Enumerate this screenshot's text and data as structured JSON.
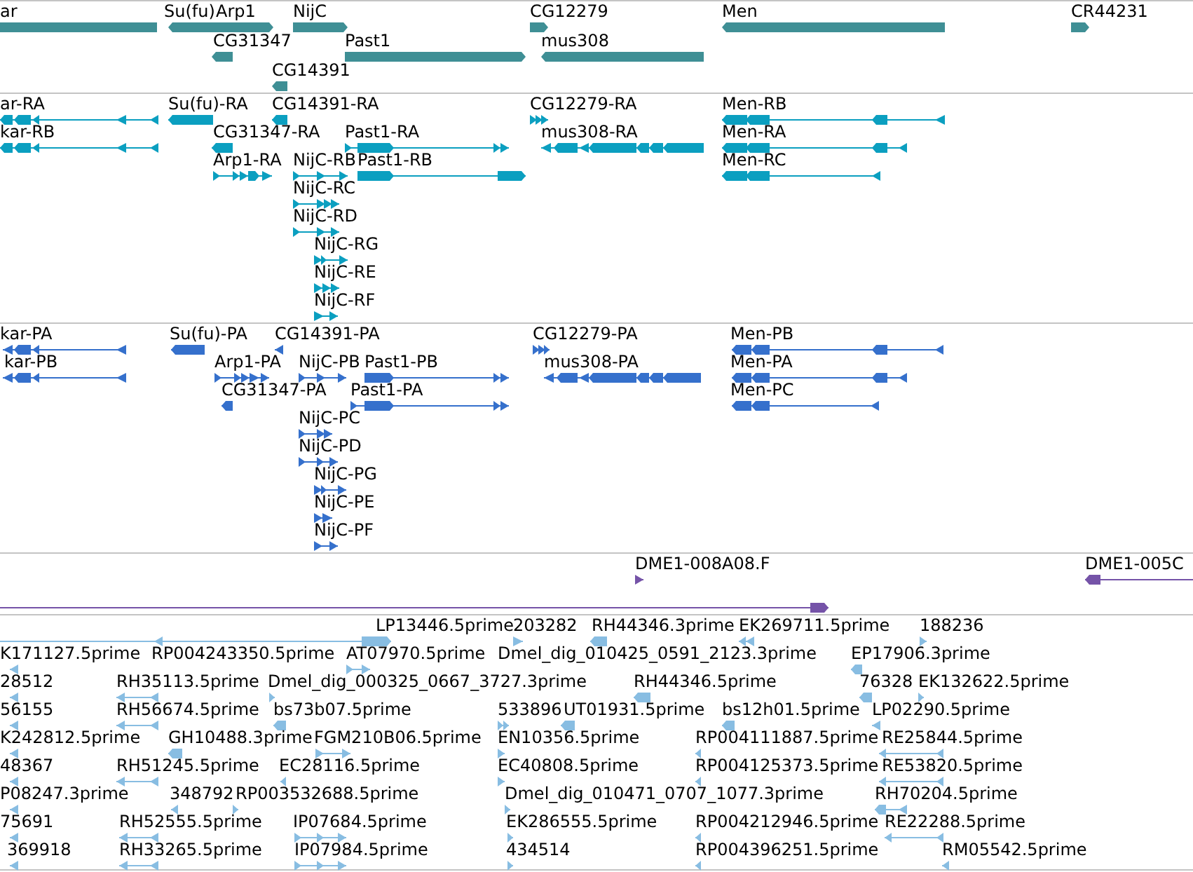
{
  "tracks": [
    {
      "kind": "gene",
      "color": "#3f8f95",
      "features": [
        {
          "label": "ar",
          "reverse": true
        },
        {
          "label": "Su(fu)",
          "reverse": true
        },
        {
          "label": "Arp1",
          "reverse": false
        },
        {
          "label": "NijC",
          "reverse": false
        },
        {
          "label": "CG12279",
          "reverse": false
        },
        {
          "label": "Men",
          "reverse": true
        },
        {
          "label": "CR44231",
          "reverse": false
        },
        {
          "label": "CG31347",
          "reverse": true
        },
        {
          "label": "Past1",
          "reverse": false
        },
        {
          "label": "mus308",
          "reverse": true
        },
        {
          "label": "CG14391",
          "reverse": true
        }
      ]
    },
    {
      "kind": "transcript",
      "color": "#0b9fc0",
      "features": [
        {
          "label": "ar-RA",
          "reverse": true
        },
        {
          "label": "Su(fu)-RA",
          "reverse": true
        },
        {
          "label": "CG14391-RA",
          "reverse": true
        },
        {
          "label": "CG12279-RA",
          "reverse": false
        },
        {
          "label": "Men-RB",
          "reverse": true
        },
        {
          "label": "kar-RB",
          "reverse": true
        },
        {
          "label": "CG31347-RA",
          "reverse": true
        },
        {
          "label": "Past1-RA",
          "reverse": false
        },
        {
          "label": "mus308-RA",
          "reverse": true
        },
        {
          "label": "Men-RA",
          "reverse": true
        },
        {
          "label": "Arp1-RA",
          "reverse": false
        },
        {
          "label": "NijC-RB",
          "reverse": false
        },
        {
          "label": "Past1-RB",
          "reverse": false
        },
        {
          "label": "Men-RC",
          "reverse": true
        },
        {
          "label": "NijC-RC",
          "reverse": false
        },
        {
          "label": "NijC-RD",
          "reverse": false
        },
        {
          "label": "NijC-RG",
          "reverse": false
        },
        {
          "label": "NijC-RE",
          "reverse": false
        },
        {
          "label": "NijC-RF",
          "reverse": false
        }
      ]
    },
    {
      "kind": "protein",
      "color": "#3570cc",
      "features": [
        {
          "label": "kar-PA",
          "reverse": true
        },
        {
          "label": "Su(fu)-PA",
          "reverse": true
        },
        {
          "label": "CG14391-PA",
          "reverse": true
        },
        {
          "label": "CG12279-PA",
          "reverse": false
        },
        {
          "label": "Men-PB",
          "reverse": true
        },
        {
          "label": "kar-PB",
          "reverse": true
        },
        {
          "label": "Arp1-PA",
          "reverse": false
        },
        {
          "label": "NijC-PB",
          "reverse": false
        },
        {
          "label": "Past1-PB",
          "reverse": false
        },
        {
          "label": "mus308-PA",
          "reverse": true
        },
        {
          "label": "Men-PA",
          "reverse": true
        },
        {
          "label": "CG31347-PA",
          "reverse": true
        },
        {
          "label": "Past1-PA",
          "reverse": false
        },
        {
          "label": "Men-PC",
          "reverse": true
        },
        {
          "label": "NijC-PC",
          "reverse": false
        },
        {
          "label": "NijC-PD",
          "reverse": false
        },
        {
          "label": "NijC-PG",
          "reverse": false
        },
        {
          "label": "NijC-PE",
          "reverse": false
        },
        {
          "label": "NijC-PF",
          "reverse": false
        }
      ]
    },
    {
      "kind": "clone",
      "color": "#7553a8",
      "features": [
        {
          "label": "DME1-008A08.F",
          "reverse": false
        },
        {
          "label": "DME1-005C",
          "reverse": true
        },
        {
          "reverse": false
        }
      ]
    },
    {
      "kind": "est",
      "color": "#88bde2",
      "features": [
        {
          "reverse": true
        },
        {
          "label": "LP13446.5prime",
          "reverse": false
        },
        {
          "label": "203282",
          "reverse": false
        },
        {
          "label": "RH44346.3prime",
          "reverse": true
        },
        {
          "label": "EK269711.5prime",
          "reverse": true
        },
        {
          "label": "188236",
          "reverse": false
        },
        {
          "label": "K171127.5prime",
          "reverse": true
        },
        {
          "label": "RP004243350.5prime"
        },
        {
          "label": "AT07970.5prime",
          "reverse": false
        },
        {
          "label": "Dmel_dig_010425_0591_2123.3prime"
        },
        {
          "label": "EP17906.3prime",
          "reverse": true
        },
        {
          "label": "28512",
          "reverse": true
        },
        {
          "label": "RH35113.5prime",
          "reverse": true
        },
        {
          "label": "Dmel_dig_000325_0667_3727.3prime",
          "reverse": false
        },
        {
          "label": "RH44346.5prime",
          "reverse": true
        },
        {
          "label": "76328",
          "reverse": true
        },
        {
          "label": "EK132622.5prime",
          "reverse": false
        },
        {
          "label": "56155",
          "reverse": true
        },
        {
          "label": "RH56674.5prime",
          "reverse": true
        },
        {
          "label": "bs73b07.5prime",
          "reverse": true
        },
        {
          "label": "533896",
          "reverse": false
        },
        {
          "label": "UT01931.5prime",
          "reverse": true
        },
        {
          "label": "bs12h01.5prime",
          "reverse": true
        },
        {
          "label": "LP02290.5prime",
          "reverse": true
        },
        {
          "label": "K242812.5prime",
          "reverse": true
        },
        {
          "label": "GH10488.3prime",
          "reverse": true
        },
        {
          "label": "FGM210B06.5prime",
          "reverse": false
        },
        {
          "label": "EN10356.5prime",
          "reverse": false
        },
        {
          "label": "RP004111887.5prime",
          "reverse": true
        },
        {
          "label": "RE25844.5prime",
          "reverse": true
        },
        {
          "label": "48367",
          "reverse": true
        },
        {
          "label": "RH51245.5prime",
          "reverse": true
        },
        {
          "label": "EC28116.5prime",
          "reverse": true
        },
        {
          "label": "EC40808.5prime",
          "reverse": false
        },
        {
          "label": "RP004125373.5prime",
          "reverse": true
        },
        {
          "label": "RE53820.5prime",
          "reverse": true
        },
        {
          "label": "P08247.3prime",
          "reverse": true
        },
        {
          "label": "348792",
          "reverse": true
        },
        {
          "label": "RP003532688.5prime",
          "reverse": false
        },
        {
          "label": "Dmel_dig_010471_0707_1077.3prime",
          "reverse": false
        },
        {
          "label": "RH70204.5prime",
          "reverse": true
        },
        {
          "label": "75691",
          "reverse": true
        },
        {
          "label": "RH52555.5prime",
          "reverse": true
        },
        {
          "label": "IP07684.5prime",
          "reverse": false
        },
        {
          "label": "EK286555.5prime",
          "reverse": false
        },
        {
          "label": "RP004212946.5prime",
          "reverse": true
        },
        {
          "label": "RE22288.5prime",
          "reverse": true
        },
        {
          "label": "369918",
          "reverse": true
        },
        {
          "label": "RH33265.5prime",
          "reverse": true
        },
        {
          "label": "IP07984.5prime",
          "reverse": false
        },
        {
          "label": "434514",
          "reverse": false
        },
        {
          "label": "RP004396251.5prime",
          "reverse": true
        },
        {
          "label": "RM05542.5prime",
          "reverse": true
        }
      ]
    }
  ]
}
